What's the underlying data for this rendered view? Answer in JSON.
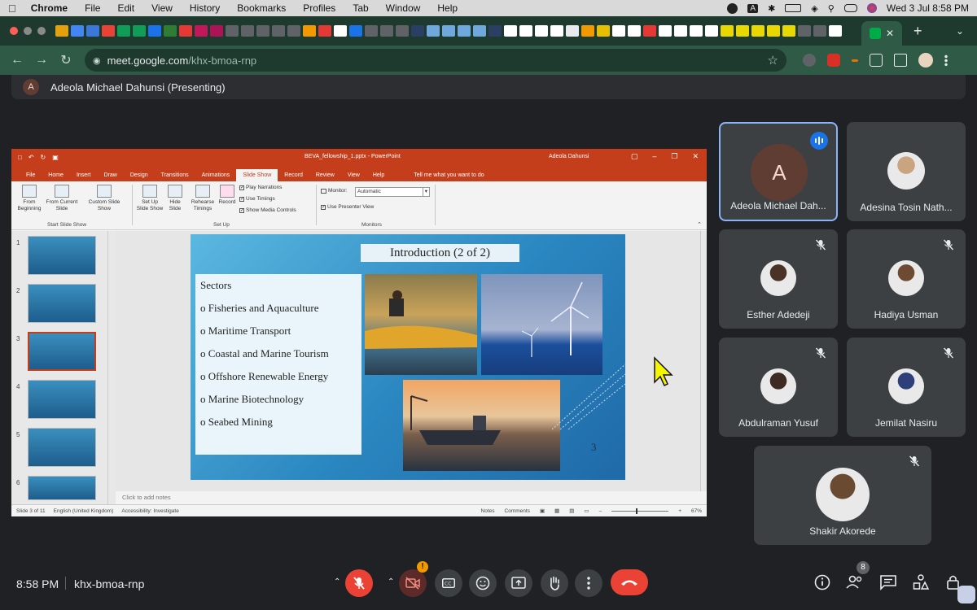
{
  "menubar": {
    "apple": "",
    "items": [
      "Chrome",
      "File",
      "Edit",
      "View",
      "History",
      "Bookmarks",
      "Profiles",
      "Tab",
      "Window",
      "Help"
    ],
    "clock": "Wed 3 Jul  8:58 PM",
    "input_source": "A"
  },
  "browser": {
    "new_tab": "+",
    "url_host": "meet.google.com",
    "url_path": "/khx-bmoa-rnp"
  },
  "meet": {
    "presenter_initial": "A",
    "presenting_label": "Adeola Michael Dahunsi (Presenting)",
    "time": "8:58 PM",
    "meeting_code": "khx-bmoa-rnp",
    "people_count": "8",
    "warning_badge": "!"
  },
  "participants": [
    {
      "name": "Adeola Michael Dah...",
      "initial": "A",
      "speaking": true
    },
    {
      "name": "Adesina Tosin Nath...",
      "muted": false
    },
    {
      "name": "Esther Adedeji",
      "muted": true
    },
    {
      "name": "Hadiya Usman",
      "muted": true
    },
    {
      "name": "Abdulraman Yusuf",
      "muted": true
    },
    {
      "name": "Jemilat Nasiru",
      "muted": true
    },
    {
      "name": "Shakir Akorede",
      "muted": true
    }
  ],
  "powerpoint": {
    "filename": "BEVA_fellowship_1.pptx  -  PowerPoint",
    "user": "Adeola Dahunsi",
    "menu_tabs": [
      "File",
      "Home",
      "Insert",
      "Draw",
      "Design",
      "Transitions",
      "Animations",
      "Slide Show",
      "Record",
      "Review",
      "View",
      "Help"
    ],
    "tell_me": "Tell me what you want to do",
    "ribbon": {
      "from_beginning": "From Beginning",
      "from_current": "From Current Slide",
      "custom_show": "Custom Slide Show",
      "group_start": "Start Slide Show",
      "set_up_show": "Set Up Slide Show",
      "hide_slide": "Hide Slide",
      "rehearse": "Rehearse Timings",
      "record": "Record",
      "group_setup": "Set Up",
      "play_narrations": "Play Narrations",
      "use_timings": "Use Timings",
      "show_media": "Show Media Controls",
      "monitor_label": "Monitor:",
      "monitor_value": "Automatic",
      "use_presenter": "Use Presenter View",
      "group_monitors": "Monitors"
    },
    "thumbnails": [
      "1",
      "2",
      "3",
      "4",
      "5",
      "6"
    ],
    "selected_slide": 3,
    "notes_placeholder": "Click to add notes",
    "status_slide": "Slide 3 of 11",
    "status_lang": "English (United Kingdom)",
    "status_access": "Accessibility: Investigate",
    "status_notes": "Notes",
    "status_comments": "Comments",
    "zoom": "67%"
  },
  "slide": {
    "title": "Introduction (2 of 2)",
    "heading": "Sectors",
    "items": [
      "Fisheries and Aquaculture",
      "Maritime Transport",
      "Coastal and Marine Tourism",
      "Offshore Renewable Energy",
      "Marine Biotechnology",
      "Seabed Mining"
    ],
    "page_number": "3"
  },
  "colors": {
    "ppt_accent": "#c43e1c",
    "meet_bg": "#202124",
    "tile_bg": "#3c4043",
    "end_call": "#ea4335",
    "speaking_border": "#8ab4f8",
    "browser_frame": "#2e5a46"
  }
}
